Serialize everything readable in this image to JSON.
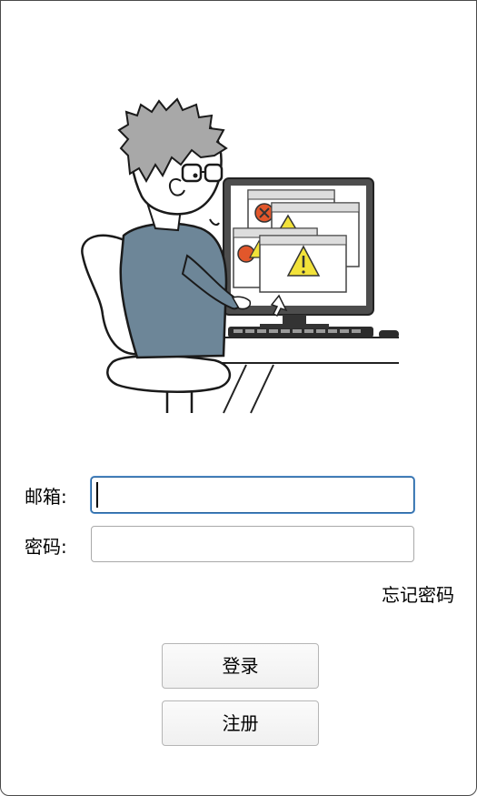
{
  "form": {
    "email_label": "邮箱:",
    "email_value": "",
    "password_label": "密码:",
    "password_value": "",
    "forgot_password_label": "忘记密码"
  },
  "buttons": {
    "login_label": "登录",
    "register_label": "注册"
  },
  "illustration": {
    "subject": "person-at-computer-with-error-dialogs"
  }
}
